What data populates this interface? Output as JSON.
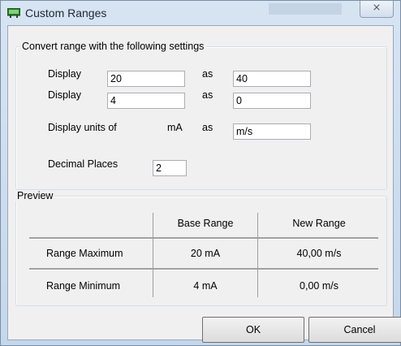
{
  "window": {
    "title": "Custom Ranges",
    "close_glyph": "⨯"
  },
  "convert_group": {
    "legend": "Convert range with the following settings",
    "row1": {
      "label": "Display",
      "from_value": "20",
      "as_label": "as",
      "to_value": "40"
    },
    "row2": {
      "label": "Display",
      "from_value": "4",
      "as_label": "as",
      "to_value": "0"
    },
    "units": {
      "label": "Display units of",
      "base_unit": "mA",
      "as_label": "as",
      "unit_value": "m/s"
    },
    "decimals": {
      "label": "Decimal Places",
      "value": "2"
    }
  },
  "preview_group": {
    "legend": "Preview",
    "columns": [
      "",
      "Base Range",
      "New Range"
    ],
    "rows": [
      {
        "label": "Range Maximum",
        "base": "20 mA",
        "new": "40,00 m/s"
      },
      {
        "label": "Range Minimum",
        "base": "4 mA",
        "new": "0,00 m/s"
      }
    ]
  },
  "buttons": {
    "ok": "OK",
    "cancel": "Cancel"
  },
  "colors": {
    "title_bar": "#c5d7eb",
    "client": "#f0f0f0",
    "group_border": "#d5dfe5"
  },
  "icons": {
    "app": "app-icon",
    "close": "close-icon"
  }
}
